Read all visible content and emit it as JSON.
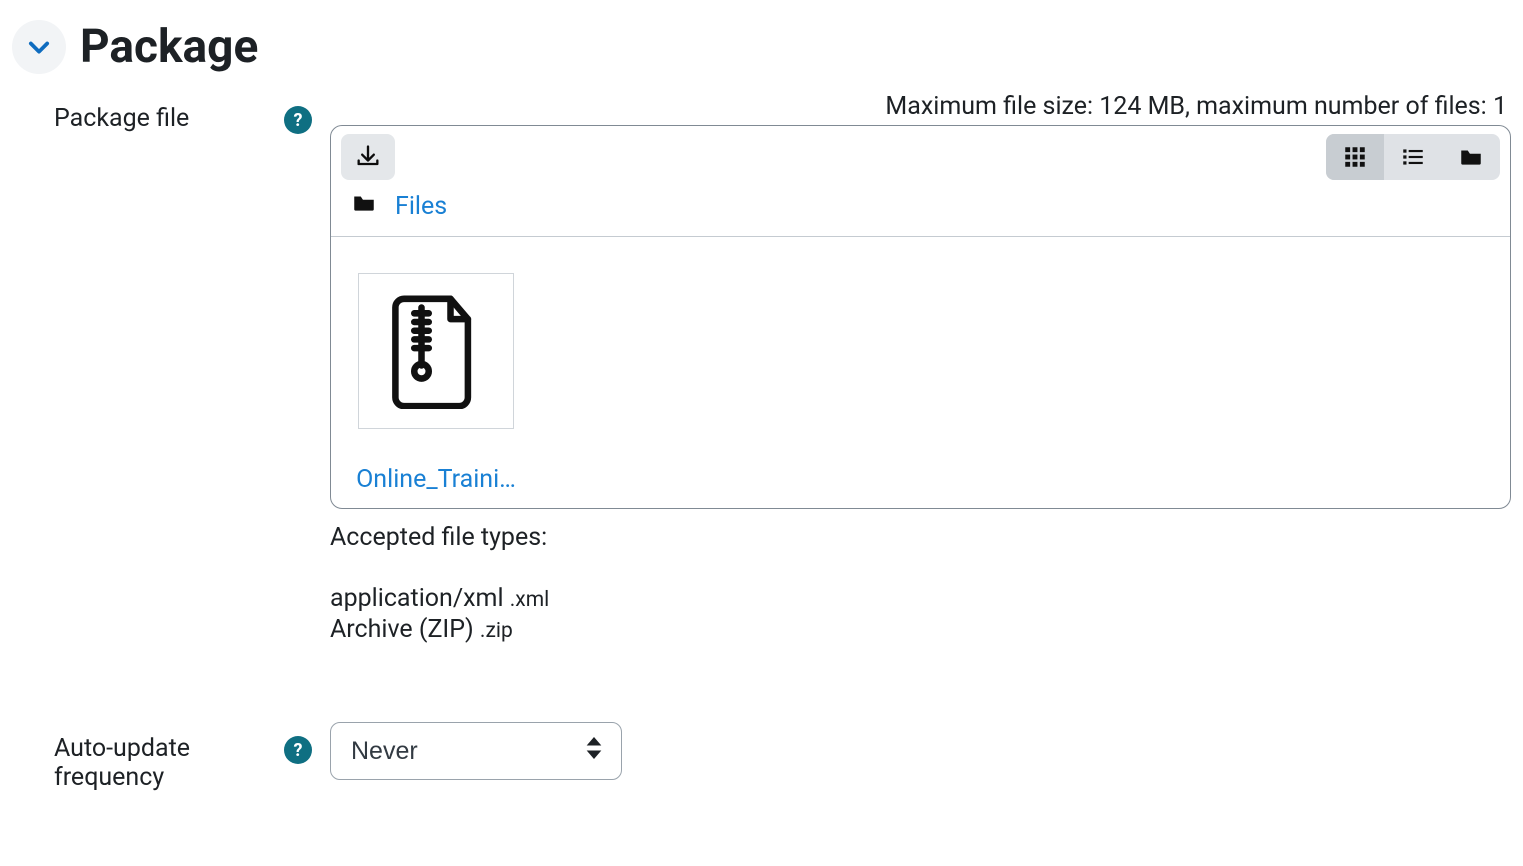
{
  "section": {
    "title": "Package"
  },
  "package_file": {
    "label": "Package file",
    "max_info": "Maximum file size: 124 MB, maximum number of files: 1",
    "breadcrumb": {
      "root_label": "Files"
    },
    "file": {
      "name": "Online_Traini…"
    },
    "accepted_label": "Accepted file types:",
    "types": [
      {
        "label": "application/xml",
        "ext": ".xml"
      },
      {
        "label": "Archive (ZIP)",
        "ext": ".zip"
      }
    ]
  },
  "auto_update": {
    "label": "Auto-update frequency",
    "value": "Never"
  }
}
